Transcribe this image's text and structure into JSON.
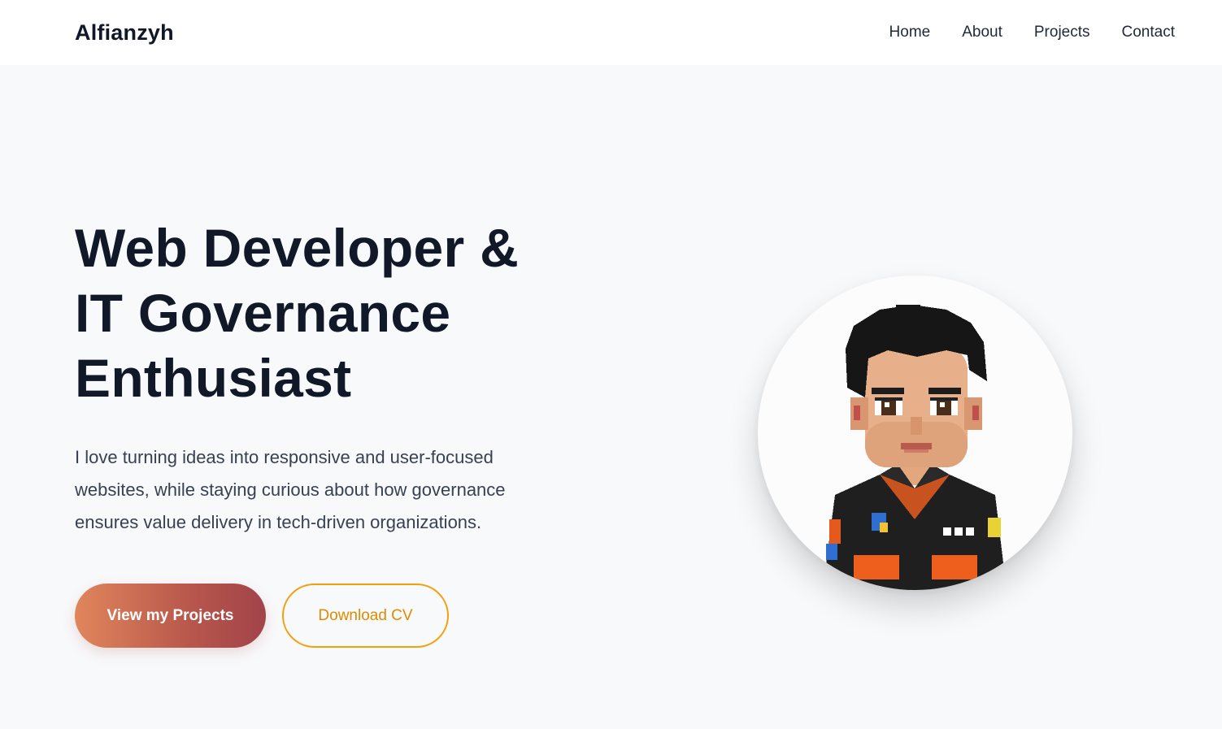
{
  "brand": {
    "name": "Alfianzyh"
  },
  "nav": {
    "items": [
      {
        "label": "Home"
      },
      {
        "label": "About"
      },
      {
        "label": "Projects"
      },
      {
        "label": "Contact"
      }
    ]
  },
  "hero": {
    "headline_line1": "Web Developer &",
    "headline_line2": "IT Governance",
    "headline_line3": "Enthusiast",
    "intro_line1": "I love turning ideas into responsive and user-focused",
    "intro_line2": "websites, while staying curious about how governance",
    "intro_line3": "ensures value delivery in tech-driven organizations.",
    "primary_button": "View my Projects",
    "secondary_button": "Download CV"
  },
  "colors": {
    "accent_orange": "#f59e0b",
    "gradient_start": "#e0865c",
    "gradient_end": "#a1434a",
    "text_dark": "#111827",
    "page_bg": "#f8f9fb"
  }
}
